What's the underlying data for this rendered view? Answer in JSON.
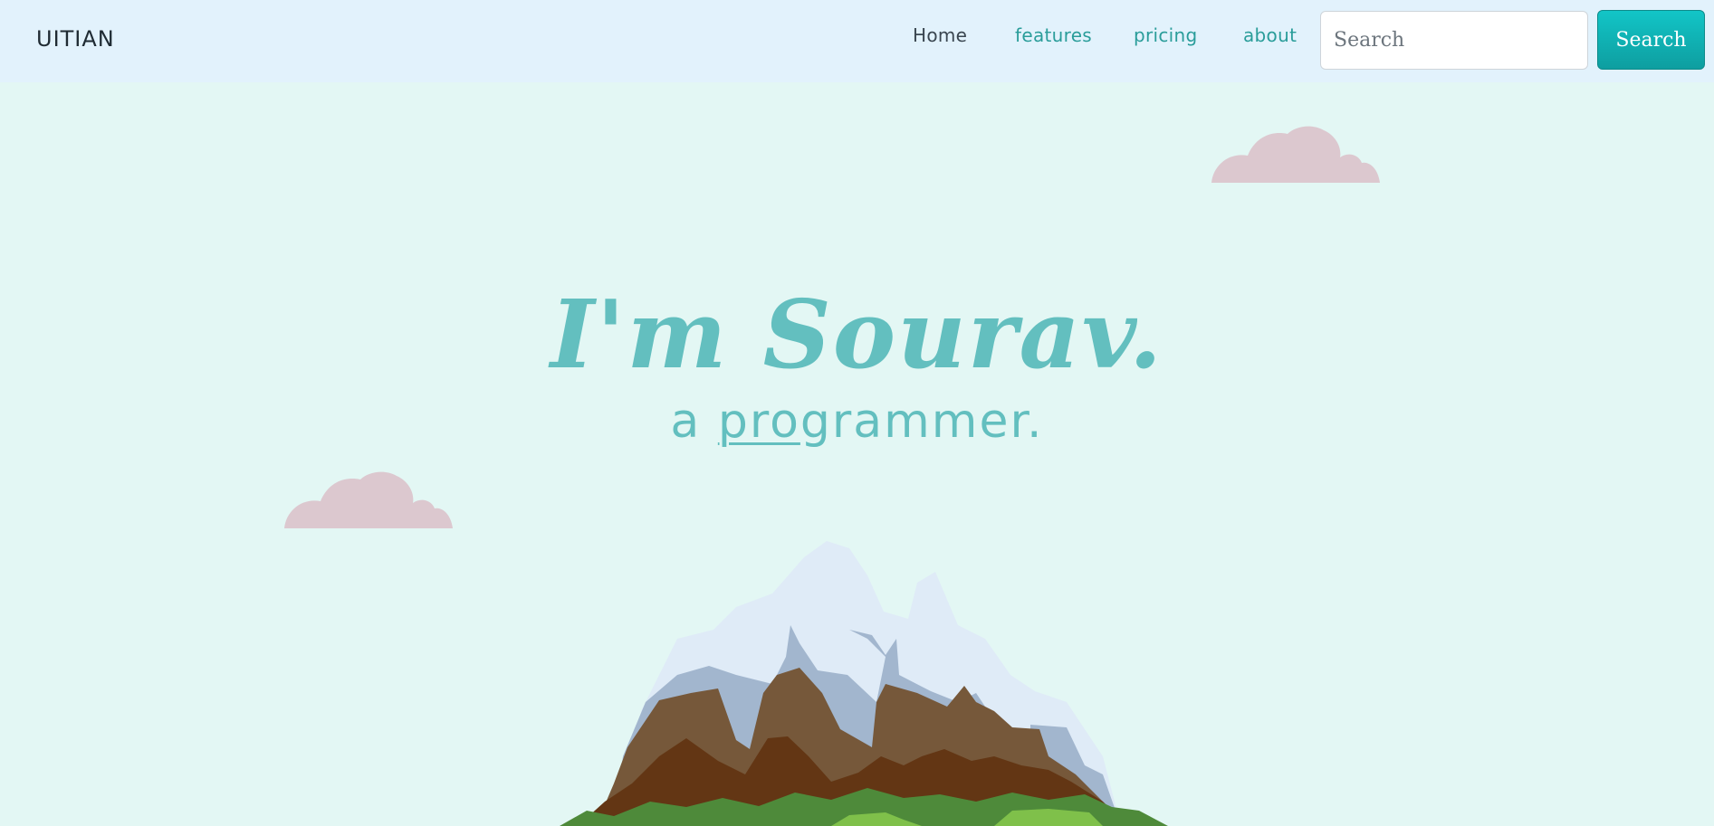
{
  "navbar": {
    "brand": "UITIAN",
    "links": [
      {
        "label": "Home"
      },
      {
        "label": "features"
      },
      {
        "label": "pricing"
      },
      {
        "label": "about"
      }
    ],
    "search_placeholder": "Search",
    "search_button_label": "Search"
  },
  "hero": {
    "title": "I'm Sourav.",
    "subtitle_prefix": "a ",
    "subtitle_typed": "pro",
    "subtitle_rest": "grammer."
  },
  "colors": {
    "page_background": "#e3f7f4",
    "navbar_background": "#e2f2fc",
    "accent_teal": "#63bfbf",
    "link_teal": "#2a9d9a",
    "button_teal": "#12c5c7",
    "cloud_pink": "#dcc8cf"
  },
  "icons": [
    "cloud-icon",
    "mountain-illustration"
  ]
}
